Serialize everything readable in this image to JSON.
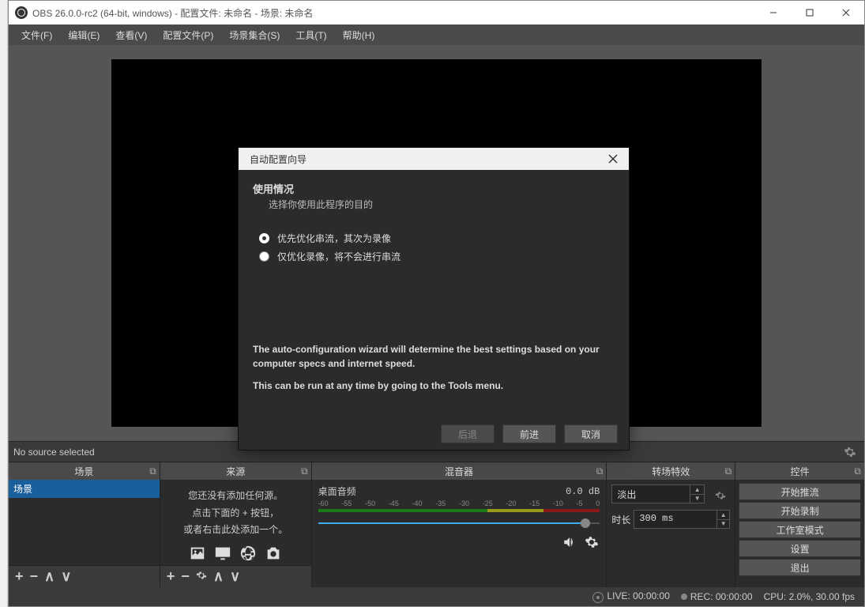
{
  "titlebar": {
    "title": "OBS 26.0.0-rc2 (64-bit, windows) - 配置文件: 未命名 - 场景: 未命名"
  },
  "menu": {
    "file": "文件(F)",
    "edit": "编辑(E)",
    "view": "查看(V)",
    "profile": "配置文件(P)",
    "scene_collection": "场景集合(S)",
    "tools": "工具(T)",
    "help": "帮助(H)"
  },
  "no_source": "No source selected",
  "docks": {
    "scenes": "场景",
    "sources": "来源",
    "mixer": "混音器",
    "transitions": "转场特效",
    "controls": "控件"
  },
  "scene_item": "场景",
  "sources_empty": {
    "l1": "您还没有添加任何源。",
    "l2": "点击下面的 + 按钮，",
    "l3": "或者右击此处添加一个。"
  },
  "mixer": {
    "channel": "桌面音频",
    "db": "0.0 dB",
    "ticks": [
      "-60",
      "-55",
      "-50",
      "-45",
      "-40",
      "-35",
      "-30",
      "-25",
      "-20",
      "-15",
      "-10",
      "-5",
      "0"
    ]
  },
  "transitions": {
    "combo": "淡出",
    "duration_label": "时长",
    "duration_value": "300 ms"
  },
  "controls": {
    "stream": "开始推流",
    "record": "开始录制",
    "studio": "工作室模式",
    "settings": "设置",
    "exit": "退出"
  },
  "status": {
    "live": "LIVE: 00:00:00",
    "rec": "REC: 00:00:00",
    "cpu": "CPU: 2.0%, 30.00 fps"
  },
  "wizard": {
    "title": "自动配置向导",
    "heading": "使用情况",
    "sub": "选择你使用此程序的目的",
    "opt1": "优先优化串流，其次为录像",
    "opt2": "仅优化录像，将不会进行串流",
    "desc1": "The auto-configuration wizard will determine the best settings based on your computer specs and internet speed.",
    "desc2": "This can be run at any time by going to the Tools menu.",
    "back": "后退",
    "next": "前进",
    "cancel": "取消"
  }
}
